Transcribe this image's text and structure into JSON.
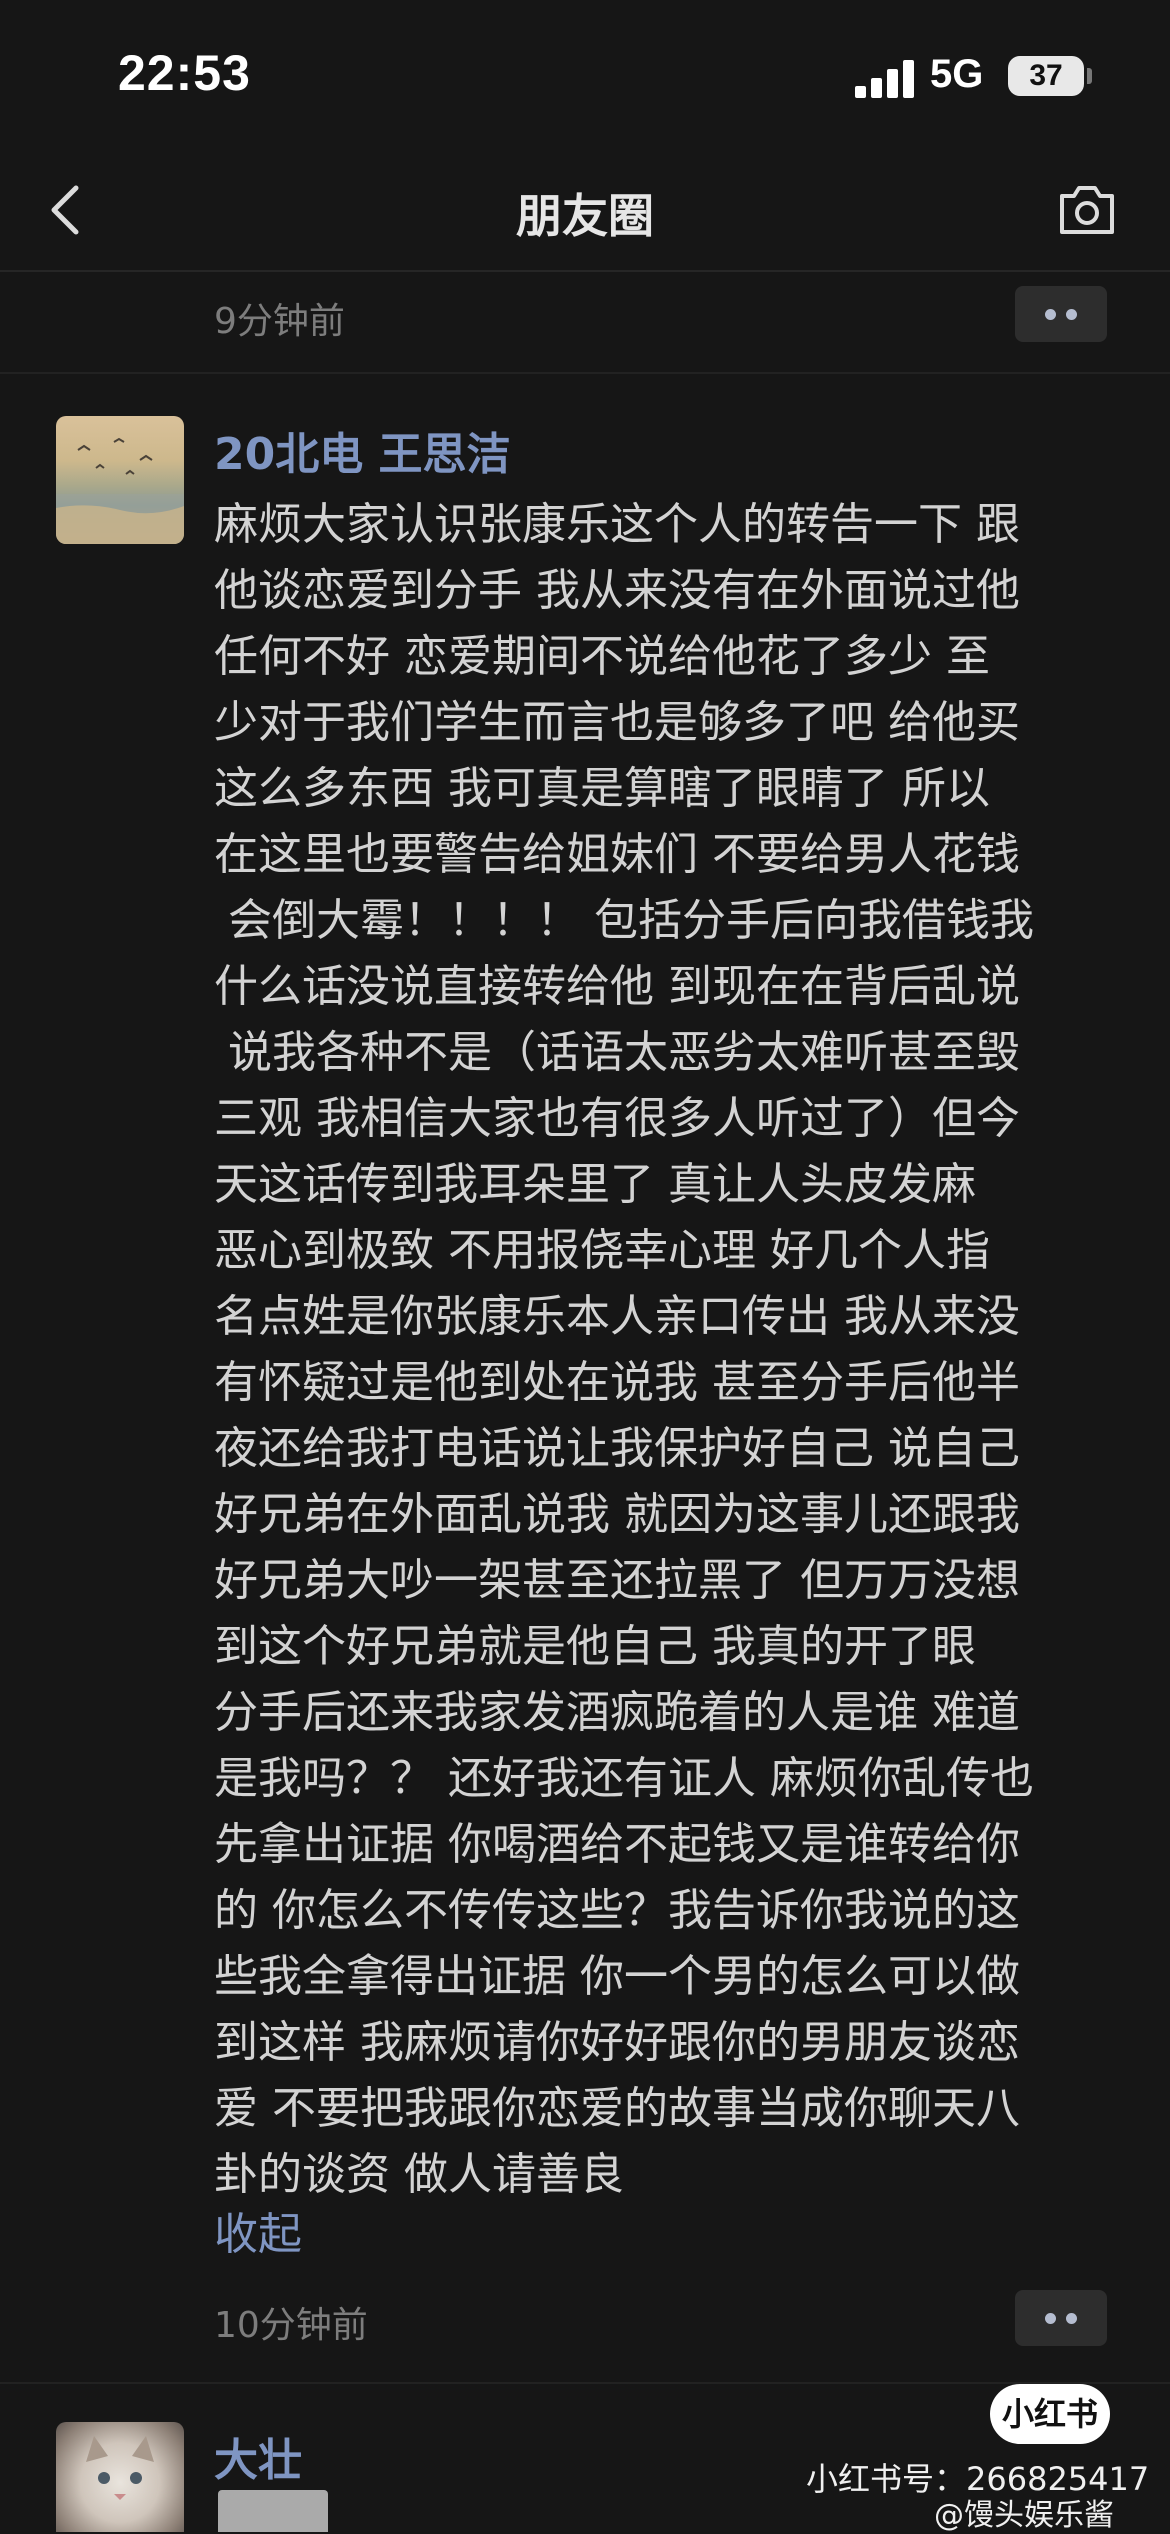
{
  "status_bar": {
    "time": "22:53",
    "network": "5G",
    "battery": "37"
  },
  "nav": {
    "title": "朋友圈"
  },
  "feed": {
    "previous_post": {
      "timestamp": "9分钟前"
    },
    "post": {
      "author": "20北电 王思洁",
      "text": "麻烦大家认识张康乐这个人的转告一下 跟\n他谈恋爱到分手 我从来没有在外面说过他\n任何不好 恋爱期间不说给他花了多少 至\n少对于我们学生而言也是够多了吧 给他买\n这么多东西 我可真是算瞎了眼睛了 所以\n在这里也要警告给姐妹们 不要给男人花钱\n 会倒大霉！！！！ 包括分手后向我借钱我\n什么话没说直接转给他 到现在在背后乱说\n 说我各种不是（话语太恶劣太难听甚至毁\n三观 我相信大家也有很多人听过了）但今\n天这话传到我耳朵里了 真让人头皮发麻\n恶心到极致 不用报侥幸心理 好几个人指\n名点姓是你张康乐本人亲口传出 我从来没\n有怀疑过是他到处在说我 甚至分手后他半\n夜还给我打电话说让我保护好自己 说自己\n好兄弟在外面乱说我 就因为这事儿还跟我\n好兄弟大吵一架甚至还拉黑了 但万万没想\n到这个好兄弟就是他自己 我真的开了眼\n分手后还来我家发酒疯跪着的人是谁 难道\n是我吗？？ 还好我还有证人 麻烦你乱传也\n先拿出证据 你喝酒给不起钱又是谁转给你\n的 你怎么不传传这些？我告诉你我说的这\n些我全拿得出证据 你一个男的怎么可以做\n到这样 我麻烦请你好好跟你的男朋友谈恋\n爱 不要把我跟你恋爱的故事当成你聊天八\n卦的谈资 做人请善良",
      "collapse_label": "收起",
      "timestamp": "10分钟前"
    },
    "next_post": {
      "author": "大壮"
    }
  },
  "watermark": {
    "badge": "小红书",
    "id_text": "小红书号：266825417",
    "brand_text": "@馒头娱乐酱"
  },
  "colors": {
    "background": "#161616",
    "link": "#7f95c2",
    "body_text": "#d3d3d3",
    "timestamp": "#7d7d7d"
  }
}
